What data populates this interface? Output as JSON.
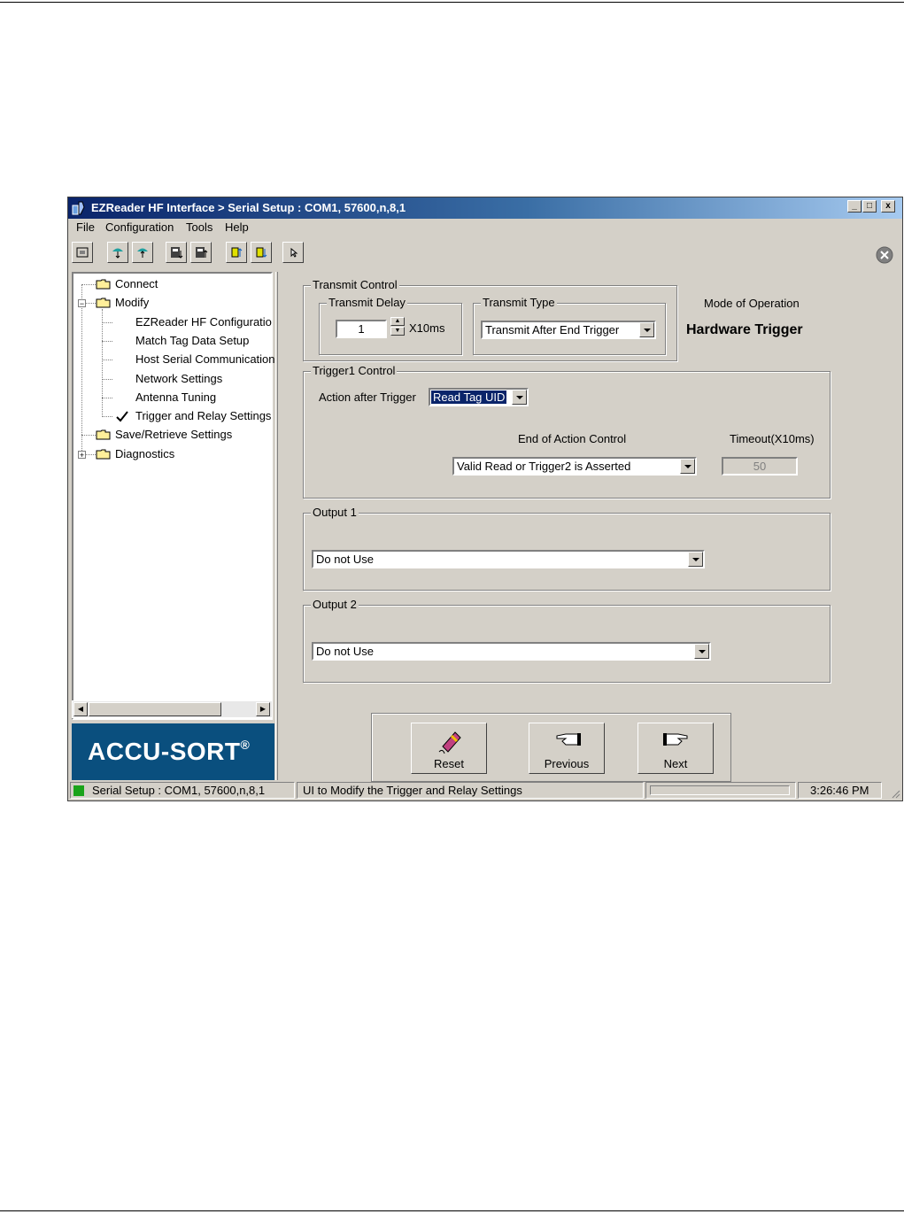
{
  "window": {
    "title": "EZReader HF Interface > Serial Setup : COM1, 57600,n,8,1",
    "controls": [
      "_",
      "□",
      "x"
    ]
  },
  "menu": [
    "File",
    "Configuration",
    "Tools",
    "Help"
  ],
  "toolbar_icons": [
    "connect-icon",
    "upload-icon",
    "download-icon",
    "save-to-reader-icon",
    "load-from-reader-icon",
    "tag-up-icon",
    "tag-down-icon",
    "pointer-icon"
  ],
  "tree": {
    "items": [
      {
        "label": "Connect"
      },
      {
        "label": "Modify"
      },
      {
        "label": "EZReader HF Configuratio"
      },
      {
        "label": "Match Tag Data Setup"
      },
      {
        "label": "Host Serial Communication"
      },
      {
        "label": "Network Settings"
      },
      {
        "label": "Antenna Tuning"
      },
      {
        "label": "Trigger and Relay Settings",
        "checked": true
      },
      {
        "label": "Save/Retrieve Settings"
      },
      {
        "label": "Diagnostics"
      }
    ]
  },
  "logo": {
    "text": "ACCU-SORT",
    "reg": "®"
  },
  "transmit_control": {
    "legend": "Transmit Control",
    "delay_legend": "Transmit Delay",
    "delay_value": "1",
    "delay_unit": "X10ms",
    "type_legend": "Transmit Type",
    "type_value": "Transmit After End Trigger"
  },
  "mode": {
    "label": "Mode of Operation",
    "value": "Hardware Trigger"
  },
  "trigger1": {
    "legend": "Trigger1 Control",
    "action_label": "Action after Trigger",
    "action_value": "Read Tag UID",
    "end_label": "End of Action Control",
    "end_value": "Valid Read or Trigger2 is Asserted",
    "timeout_label": "Timeout(X10ms)",
    "timeout_value": "50"
  },
  "output1": {
    "legend": "Output 1",
    "value": "Do not Use"
  },
  "output2": {
    "legend": "Output 2",
    "value": "Do not Use"
  },
  "nav": {
    "reset": "Reset",
    "previous": "Previous",
    "next": "Next"
  },
  "status": {
    "connection": "Serial Setup : COM1, 57600,n,8,1",
    "message": "UI to Modify the Trigger and Relay Settings",
    "time": "3:26:46 PM"
  }
}
